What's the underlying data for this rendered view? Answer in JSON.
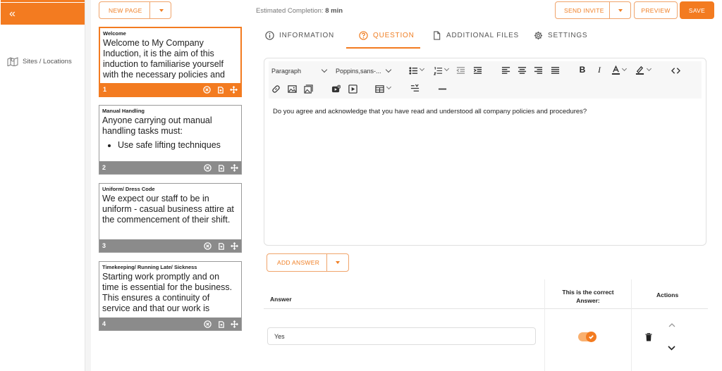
{
  "sidebar": {
    "toggle_glyph": "«",
    "items": [
      {
        "label": "Sites / Locations",
        "icon": "map-icon"
      }
    ]
  },
  "toolbar": {
    "new_page_label": "NEW PAGE",
    "estimate_label": "Estimated Completion:",
    "estimate_value": "8 min",
    "send_invite_label": "SEND INVITE",
    "preview_label": "PREVIEW",
    "save_label": "SAVE"
  },
  "pages": [
    {
      "number": "1",
      "title": "Welcome",
      "body": "Welcome to My Company Induction, it is the aim of this induction to familiarise yourself with the necessary policies and procedures of our company.",
      "active": true
    },
    {
      "number": "2",
      "title": "Manual Handling",
      "body": "Anyone carrying out manual handling tasks must:",
      "bullet": "Use safe lifting techniques",
      "active": false
    },
    {
      "number": "3",
      "title": "Uniform/ Dress Code",
      "body": "We expect our staff to be in uniform - casual business attire at the commencement of their shift.",
      "active": false
    },
    {
      "number": "4",
      "title": "Timekeeping/ Running Late/ Sickness",
      "body": "Starting work promptly and on time is essential for the business. This ensures a continuity of service and that our work is carried out efficiently.",
      "active": false
    }
  ],
  "tabs": [
    {
      "label": "INFORMATION",
      "icon": "info-icon"
    },
    {
      "label": "QUESTION",
      "icon": "question-icon",
      "active": true
    },
    {
      "label": "ADDITIONAL FILES",
      "icon": "file-icon"
    },
    {
      "label": "SETTINGS",
      "icon": "gear-icon"
    }
  ],
  "editor": {
    "block_format": "Paragraph",
    "font_family": "Poppins,sans-...",
    "content": "Do you agree and acknowledge that you have read and understood all company policies and procedures?"
  },
  "answers": {
    "add_answer_label": "ADD ANSWER",
    "col_answer": "Answer",
    "col_correct": "This is the correct Answer:",
    "col_actions": "Actions",
    "rows": [
      {
        "value": "Yes",
        "correct": true
      }
    ]
  },
  "colors": {
    "accent": "#f37b20",
    "card_footer": "#8b8b8b"
  }
}
